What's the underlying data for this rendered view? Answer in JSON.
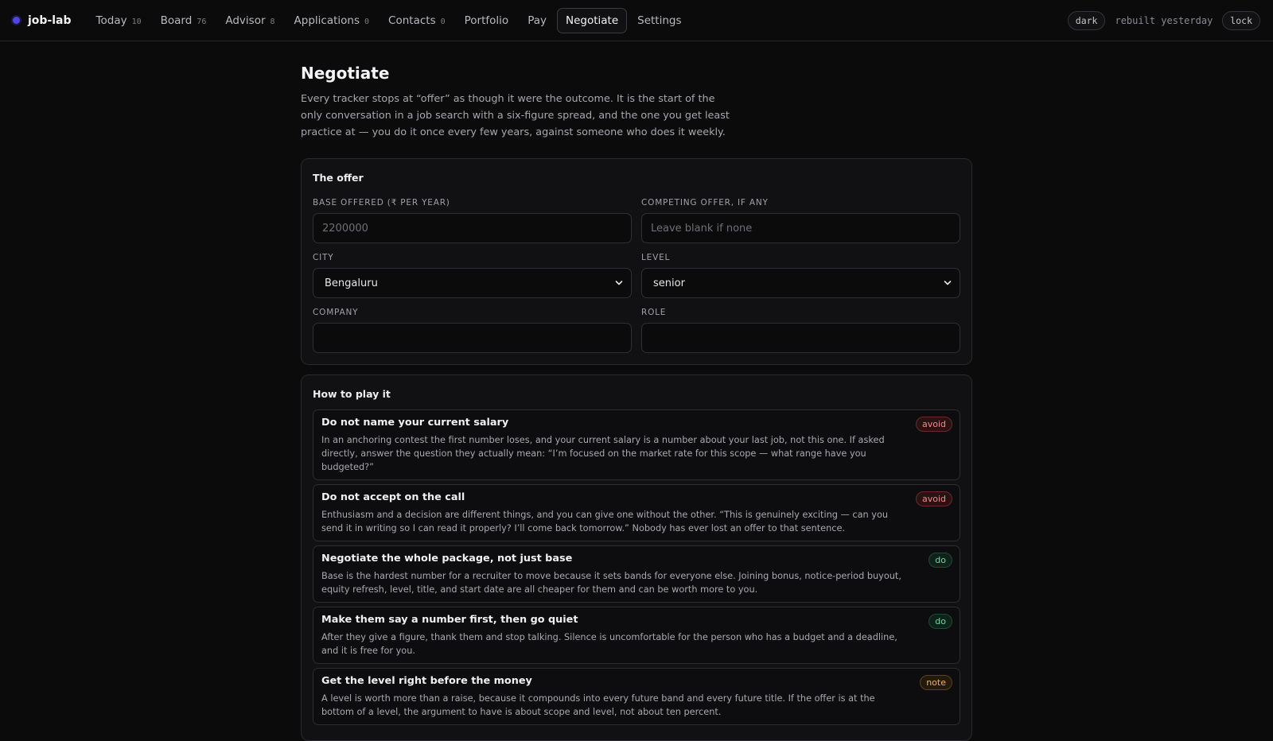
{
  "app": {
    "name": "job-lab"
  },
  "nav": [
    {
      "label": "Today",
      "count": "10"
    },
    {
      "label": "Board",
      "count": "76"
    },
    {
      "label": "Advisor",
      "count": "8"
    },
    {
      "label": "Applications",
      "count": "0"
    },
    {
      "label": "Contacts",
      "count": "0"
    },
    {
      "label": "Portfolio",
      "count": ""
    },
    {
      "label": "Pay",
      "count": ""
    },
    {
      "label": "Negotiate",
      "count": ""
    },
    {
      "label": "Settings",
      "count": ""
    }
  ],
  "active_nav": "Negotiate",
  "topbar": {
    "theme_label": "dark",
    "rebuilt": "rebuilt yesterday",
    "lock_label": "lock"
  },
  "page": {
    "title": "Negotiate",
    "intro": "Every tracker stops at “offer” as though it were the outcome. It is the start of the only conversation in a job search with a six-figure spread, and the one you get least practice at — you do it once every few years, against someone who does it weekly."
  },
  "offer": {
    "title": "The offer",
    "base_label": "BASE OFFERED (₹ PER YEAR)",
    "base_placeholder": "2200000",
    "base_value": "",
    "competing_label": "COMPETING OFFER, IF ANY",
    "competing_placeholder": "Leave blank if none",
    "competing_value": "",
    "city_label": "CITY",
    "city_value": "Bengaluru",
    "level_label": "LEVEL",
    "level_value": "senior",
    "company_label": "COMPANY",
    "company_value": "",
    "role_label": "ROLE",
    "role_value": ""
  },
  "howto": {
    "title": "How to play it",
    "tips": [
      {
        "title": "Do not name your current salary",
        "badge": "avoid",
        "body": "In an anchoring contest the first number loses, and your current salary is a number about your last job, not this one. If asked directly, answer the question they actually mean: “I’m focused on the market rate for this scope — what range have you budgeted?”"
      },
      {
        "title": "Do not accept on the call",
        "badge": "avoid",
        "body": "Enthusiasm and a decision are different things, and you can give one without the other. “This is genuinely exciting — can you send it in writing so I can read it properly? I’ll come back tomorrow.” Nobody has ever lost an offer to that sentence."
      },
      {
        "title": "Negotiate the whole package, not just base",
        "badge": "do",
        "body": "Base is the hardest number for a recruiter to move because it sets bands for everyone else. Joining bonus, notice-period buyout, equity refresh, level, title, and start date are all cheaper for them and can be worth more to you."
      },
      {
        "title": "Make them say a number first, then go quiet",
        "badge": "do",
        "body": "After they give a figure, thank them and stop talking. Silence is uncomfortable for the person who has a budget and a deadline, and it is free for you."
      },
      {
        "title": "Get the level right before the money",
        "badge": "note",
        "body": "A level is worth more than a raise, because it compounds into every future band and every future title. If the offer is at the bottom of a level, the argument to have is about scope and level, not about ten percent."
      }
    ]
  }
}
